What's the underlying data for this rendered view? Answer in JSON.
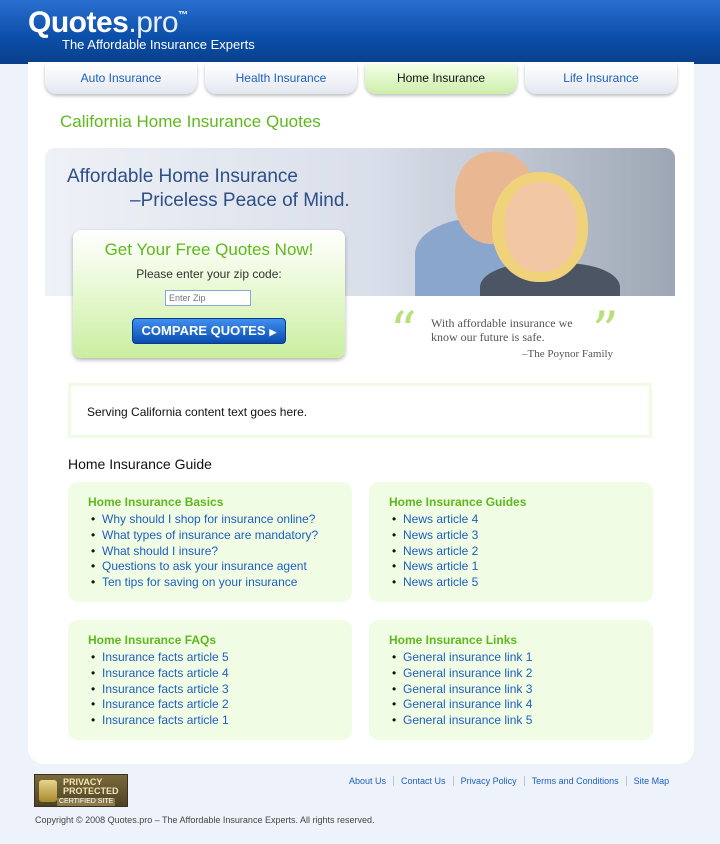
{
  "header": {
    "logo_main": "Quotes",
    "logo_pro": ".pro",
    "logo_tm": "™",
    "tagline": "The Affordable Insurance Experts"
  },
  "tabs": [
    {
      "label": "Auto Insurance",
      "active": false
    },
    {
      "label": "Health Insurance",
      "active": false
    },
    {
      "label": "Home Insurance",
      "active": true
    },
    {
      "label": "Life Insurance",
      "active": false
    }
  ],
  "page_title": "California Home Insurance Quotes",
  "hero": {
    "line1": "Affordable Home Insurance",
    "line2": "–Priceless Peace of Mind."
  },
  "quote_form": {
    "title": "Get Your Free Quotes Now!",
    "prompt": "Please enter your zip code:",
    "zip_placeholder": "Enter Zip",
    "button_label": "COMPARE QUOTES",
    "button_arrow": "▶"
  },
  "testimonial": {
    "open_mark": "“",
    "close_mark": "”",
    "text": "With affordable insurance we know our future is safe.",
    "author": "–The Poynor Family"
  },
  "content_text": "Serving California content text goes here.",
  "guide": {
    "title": "Home Insurance Guide",
    "cards": [
      {
        "title": "Home Insurance Basics",
        "items": [
          "Why should I shop for insurance online?",
          "What types of insurance are mandatory?",
          "What should I insure?",
          "Questions to ask your insurance agent",
          "Ten tips for saving on your insurance"
        ]
      },
      {
        "title": "Home Insurance Guides",
        "items": [
          "News article 4",
          "News article 3",
          "News article 2",
          "News article 1",
          "News article 5"
        ]
      },
      {
        "title": "Home Insurance FAQs",
        "items": [
          "Insurance facts article 5",
          "Insurance facts article 4",
          "Insurance facts article 3",
          "Insurance facts article 2",
          "Insurance facts article 1"
        ]
      },
      {
        "title": "Home Insurance Links",
        "items": [
          "General insurance link 1",
          "General insurance link 2",
          "General insurance link 3",
          "General insurance link 4",
          "General insurance link 5"
        ]
      }
    ]
  },
  "footer": {
    "badge_line1": "PRIVACY",
    "badge_line2": "PROTECTED",
    "badge_line3": "CERTIFIED SITE",
    "links": [
      "About Us",
      "Contact Us",
      "Privacy Policy",
      "Terms and Conditions",
      "Site Map"
    ],
    "copyright": "Copyright © 2008 Quotes.pro – The Affordable Insurance Experts. All rights reserved."
  },
  "colors": {
    "brand_blue": "#0b4ea8",
    "accent_green": "#5fb81e",
    "link_blue": "#1d5fbf",
    "card_bg": "#f1fce4"
  }
}
